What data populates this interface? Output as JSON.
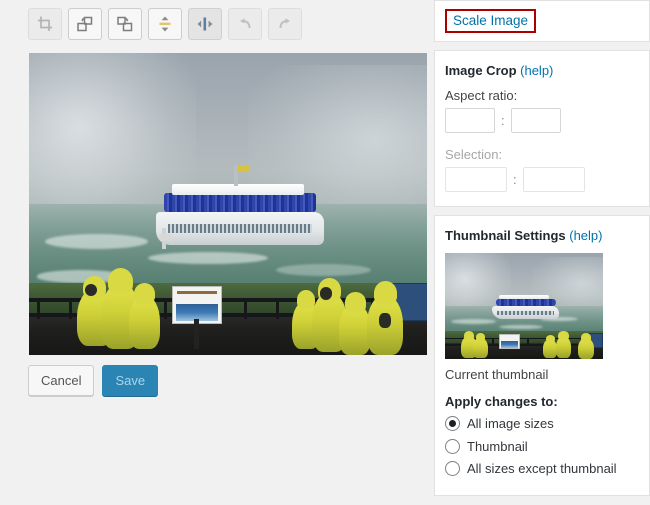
{
  "toolbar": {
    "buttons": [
      {
        "name": "crop",
        "label": "Crop",
        "state": "disabled"
      },
      {
        "name": "rotate-left",
        "label": "Rotate counter-clockwise",
        "state": "enabled"
      },
      {
        "name": "rotate-right",
        "label": "Rotate clockwise",
        "state": "enabled"
      },
      {
        "name": "flip-vertical",
        "label": "Flip vertically",
        "state": "enabled"
      },
      {
        "name": "flip-horizontal",
        "label": "Flip horizontally",
        "state": "enabled"
      },
      {
        "name": "undo",
        "label": "Undo",
        "state": "disabled"
      },
      {
        "name": "redo",
        "label": "Redo",
        "state": "disabled"
      }
    ]
  },
  "actions": {
    "cancel_label": "Cancel",
    "save_label": "Save"
  },
  "scale_panel": {
    "link_label": "Scale Image",
    "highlight_color": "#aa0000",
    "link_color": "#0073aa"
  },
  "crop_panel": {
    "title": "Image Crop",
    "help_label": "(help)",
    "aspect_ratio_label": "Aspect ratio:",
    "aspect_ratio_width": "",
    "aspect_ratio_height": "",
    "selection_label": "Selection:",
    "selection_width": "",
    "selection_height": "",
    "separator": ":"
  },
  "thumbnail_panel": {
    "title": "Thumbnail Settings",
    "help_label": "(help)",
    "caption": "Current thumbnail",
    "apply_title": "Apply changes to:",
    "options": [
      {
        "label": "All image sizes",
        "checked": true
      },
      {
        "label": "Thumbnail",
        "checked": false
      },
      {
        "label": "All sizes except thumbnail",
        "checked": false
      }
    ]
  },
  "image": {
    "alt": "Maid of the Mist tour boat with blue-poncho passengers on misty green water at Niagara Falls, viewers in yellow ponchos at a railed overlook in the foreground"
  }
}
